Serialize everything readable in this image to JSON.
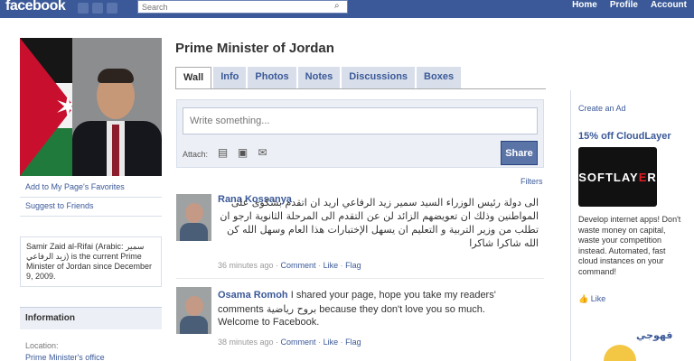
{
  "topbar": {
    "logo": "facebook",
    "search_placeholder": "Search",
    "nav": [
      "Home",
      "Profile",
      "Account"
    ]
  },
  "left": {
    "links": [
      "Add to My Page's Favorites",
      "Suggest to Friends"
    ],
    "about": "Samir Zaid al-Rifai (Arabic: سمير زيد الرفاعي) is the current Prime Minister of Jordan since December 9, 2009.",
    "info_heading": "Information",
    "info_label": "Location:",
    "info_value": "Prime Minister's office"
  },
  "page": {
    "title": "Prime Minister of Jordan",
    "tabs": [
      "Wall",
      "Info",
      "Photos",
      "Notes",
      "Discussions",
      "Boxes"
    ]
  },
  "composer": {
    "placeholder": "Write something...",
    "attach_label": "Attach:",
    "share_label": "Share"
  },
  "filters_label": "Filters",
  "posts": [
    {
      "author": "Rana Kossanya",
      "text": "الى دولة رئيس الوزراء السيد سمير زيد الرفاعي اريد ان اتقدم بشكوى على المواطنين وذلك ان تعويضهم الزائد لن عن التقدم الى المرحلة الثانوية ارجو ان تطلب من وزير التربية و التعليم ان يسهل الإختبارات هذا العام وسهل الله كن الله شاكرا شاكرا",
      "time": "36 minutes ago",
      "comment": "Comment",
      "like": "Like",
      "flag": "Flag"
    },
    {
      "author": "Osama Romoh",
      "text_inline": "I shared your page, hope you take my readers'",
      "text_line2": "comments",
      "text_rtl_snippet": "بروح رياضية",
      "text_line2_tail": "because they don't love you so much.",
      "text_line3": "Welcome to Facebook.",
      "time": "38 minutes ago",
      "comment": "Comment",
      "like": "Like",
      "flag": "Flag"
    }
  ],
  "right": {
    "create_ad": "Create an Ad",
    "ad_title": "15% off CloudLayer",
    "ad_logo_a": "SOFTLAY",
    "ad_logo_b": "E",
    "ad_logo_c": "R",
    "ad_text": "Develop internet apps! Don't waste money on capital, waste your competition instead. Automated, fast cloud instances on your command!",
    "ad_like": "Like",
    "ad2_title": "قهوجي"
  }
}
